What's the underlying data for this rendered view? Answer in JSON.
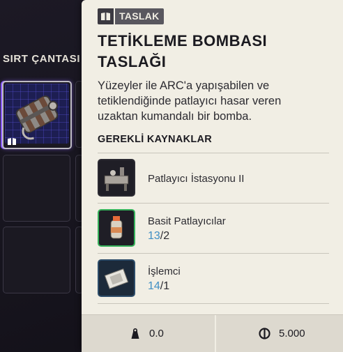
{
  "inventory": {
    "title": "SIRT ÇANTASI"
  },
  "tooltip": {
    "tag_label": "TASLAK",
    "title": "TETİKLEME BOMBASI TASLAĞI",
    "description": "Yüzeyler ile ARC'a yapışabilen ve tetiklendiğinde patlayıcı hasar veren uzaktan kumandalı bir bomba.",
    "requirements_header": "GEREKLİ KAYNAKLAR",
    "requirements": [
      {
        "name": "Patlayıcı İstasyonu II",
        "have": "",
        "need": ""
      },
      {
        "name": "Basit Patlayıcılar",
        "have": "13",
        "need": "/2"
      },
      {
        "name": "İşlemci",
        "have": "14",
        "need": "/1"
      }
    ],
    "footer": {
      "weight": "0.0",
      "price": "5.000"
    }
  },
  "colors": {
    "panel_bg": "#f1eee4",
    "count_have": "#3f8fc4",
    "rare_border": "#36b25b",
    "selection": "#8a5cff"
  },
  "icons": {
    "tag": "book-icon",
    "weight": "weight-icon",
    "currency": "coin-icon"
  }
}
